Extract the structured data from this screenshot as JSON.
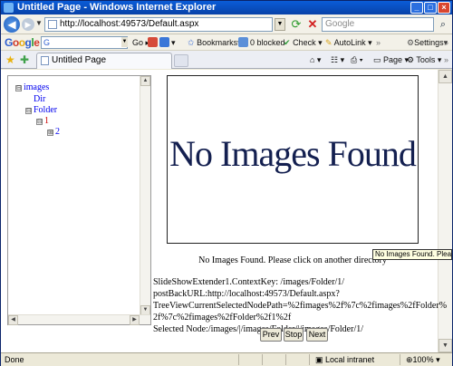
{
  "window": {
    "title": "Untitled Page - Windows Internet Explorer"
  },
  "address_bar": {
    "url": "http://localhost:49573/Default.aspx",
    "search_placeholder": "Google"
  },
  "google_toolbar": {
    "logo": [
      "G",
      "o",
      "o",
      "g",
      "l",
      "e"
    ],
    "search_value": "G",
    "go_label": "Go",
    "bookmarks_label": "Bookmarks",
    "blocked_label": "0 blocked",
    "check_label": "Check",
    "autolink_label": "AutoLink",
    "settings_label": "Settings"
  },
  "tabs": [
    {
      "label": "Untitled Page"
    }
  ],
  "command_bar": {
    "page_label": "Page",
    "tools_label": "Tools"
  },
  "tree": {
    "nodes": [
      {
        "label": "images",
        "toggle": "⊟"
      },
      {
        "label": "Dir",
        "toggle": ""
      },
      {
        "label": "Folder",
        "toggle": "⊟"
      },
      {
        "label": "1",
        "toggle": "⊟"
      },
      {
        "label": "2",
        "toggle": "⊞"
      }
    ]
  },
  "viewer": {
    "placeholder": "No Images Found",
    "caption": "No Images Found. Please click on another directory",
    "tooltip": "No Images Found. Please click"
  },
  "info": {
    "lines": [
      "SlideShowExtender1.ContextKey: /images/Folder/1/",
      "postBackURL:http://localhost:49573/Default.aspx?",
      "TreeViewCurrentSelectedNodePath=%2fimages%2f%7c%2fimages%2fFolder%",
      "2f%7c%2fimages%2fFolder%2f1%2f",
      "Selected Node:/images/|/images/Folder/|/images/Folder/1/"
    ]
  },
  "controls": {
    "prev_label": "Prev",
    "stop_label": "Stop",
    "next_label": "Next"
  },
  "status": {
    "text": "Done",
    "zone": "Local intranet",
    "zoom": "100%"
  }
}
